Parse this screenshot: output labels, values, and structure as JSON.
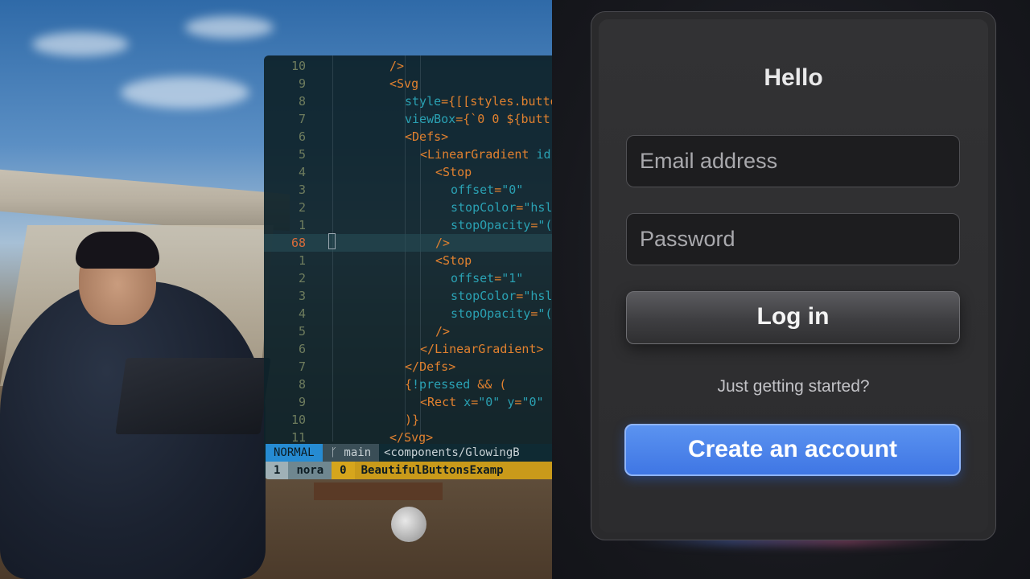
{
  "editor": {
    "lines": [
      {
        "num": "10",
        "indent": 0,
        "parts": [
          [
            "punct",
            "/>"
          ]
        ]
      },
      {
        "num": "9",
        "indent": 0,
        "parts": [
          [
            "punct",
            "<"
          ],
          [
            "tag",
            "Svg"
          ]
        ]
      },
      {
        "num": "8",
        "indent": 1,
        "parts": [
          [
            "attr",
            "style"
          ],
          [
            "punct",
            "={[[styles.butto"
          ]
        ]
      },
      {
        "num": "7",
        "indent": 1,
        "parts": [
          [
            "attr",
            "viewBox"
          ],
          [
            "punct",
            "={`0 0 ${butt"
          ]
        ]
      },
      {
        "num": "6",
        "indent": 1,
        "parts": [
          [
            "punct",
            "<"
          ],
          [
            "tag",
            "Defs"
          ],
          [
            "punct",
            ">"
          ]
        ]
      },
      {
        "num": "5",
        "indent": 2,
        "parts": [
          [
            "punct",
            "<"
          ],
          [
            "tag",
            "LinearGradient"
          ],
          [
            "attr",
            " id"
          ]
        ]
      },
      {
        "num": "4",
        "indent": 3,
        "parts": [
          [
            "punct",
            "<"
          ],
          [
            "tag",
            "Stop"
          ]
        ]
      },
      {
        "num": "3",
        "indent": 4,
        "parts": [
          [
            "attr",
            "offset"
          ],
          [
            "punct",
            "="
          ],
          [
            "str",
            "\"0\""
          ]
        ]
      },
      {
        "num": "2",
        "indent": 4,
        "parts": [
          [
            "attr",
            "stopColor"
          ],
          [
            "punct",
            "="
          ],
          [
            "str",
            "\"hsl"
          ]
        ]
      },
      {
        "num": "1",
        "indent": 4,
        "parts": [
          [
            "attr",
            "stopOpacity"
          ],
          [
            "punct",
            "="
          ],
          [
            "str",
            "\"("
          ]
        ]
      },
      {
        "num": "68",
        "indent": 3,
        "parts": [
          [
            "punct",
            "/>"
          ]
        ],
        "current": true
      },
      {
        "num": "1",
        "indent": 3,
        "parts": [
          [
            "punct",
            "<"
          ],
          [
            "tag",
            "Stop"
          ]
        ]
      },
      {
        "num": "2",
        "indent": 4,
        "parts": [
          [
            "attr",
            "offset"
          ],
          [
            "punct",
            "="
          ],
          [
            "str",
            "\"1\""
          ]
        ]
      },
      {
        "num": "3",
        "indent": 4,
        "parts": [
          [
            "attr",
            "stopColor"
          ],
          [
            "punct",
            "="
          ],
          [
            "str",
            "\"hsl"
          ]
        ]
      },
      {
        "num": "4",
        "indent": 4,
        "parts": [
          [
            "attr",
            "stopOpacity"
          ],
          [
            "punct",
            "="
          ],
          [
            "str",
            "\"("
          ]
        ]
      },
      {
        "num": "5",
        "indent": 3,
        "parts": [
          [
            "punct",
            "/>"
          ]
        ]
      },
      {
        "num": "6",
        "indent": 2,
        "parts": [
          [
            "punct",
            "</"
          ],
          [
            "tag",
            "LinearGradient"
          ],
          [
            "punct",
            ">"
          ]
        ]
      },
      {
        "num": "7",
        "indent": 1,
        "parts": [
          [
            "punct",
            "</"
          ],
          [
            "tag",
            "Defs"
          ],
          [
            "punct",
            ">"
          ]
        ]
      },
      {
        "num": "8",
        "indent": 1,
        "parts": [
          [
            "punct",
            "{"
          ],
          [
            "attr",
            "!pressed"
          ],
          [
            "punct",
            " && ("
          ]
        ]
      },
      {
        "num": "9",
        "indent": 2,
        "parts": [
          [
            "punct",
            "<"
          ],
          [
            "tag",
            "Rect"
          ],
          [
            "attr",
            " x"
          ],
          [
            "punct",
            "="
          ],
          [
            "str",
            "\"0\""
          ],
          [
            "attr",
            " y"
          ],
          [
            "punct",
            "="
          ],
          [
            "str",
            "\"0\""
          ]
        ]
      },
      {
        "num": "10",
        "indent": 1,
        "parts": [
          [
            "punct",
            ")}"
          ]
        ]
      },
      {
        "num": "11",
        "indent": 0,
        "parts": [
          [
            "punct",
            "</"
          ],
          [
            "tag",
            "Svg"
          ],
          [
            "punct",
            ">"
          ]
        ]
      }
    ],
    "status": {
      "mode": "NORMAL",
      "branch": "ᚴ main",
      "path": "<components/GlowingB"
    },
    "tabline": {
      "tab_number": "1",
      "session": "nora",
      "window_index": "0",
      "file": "BeautifulButtonsExamp"
    }
  },
  "login": {
    "title": "Hello",
    "email_placeholder": "Email address",
    "password_placeholder": "Password",
    "login_label": "Log in",
    "prompt": "Just getting started?",
    "create_label": "Create an account"
  },
  "colors": {
    "accent": "#4a80ea",
    "panel": "#2c2c2e",
    "editor_bg": "#0e222a",
    "mode_bg": "#268bd2"
  }
}
